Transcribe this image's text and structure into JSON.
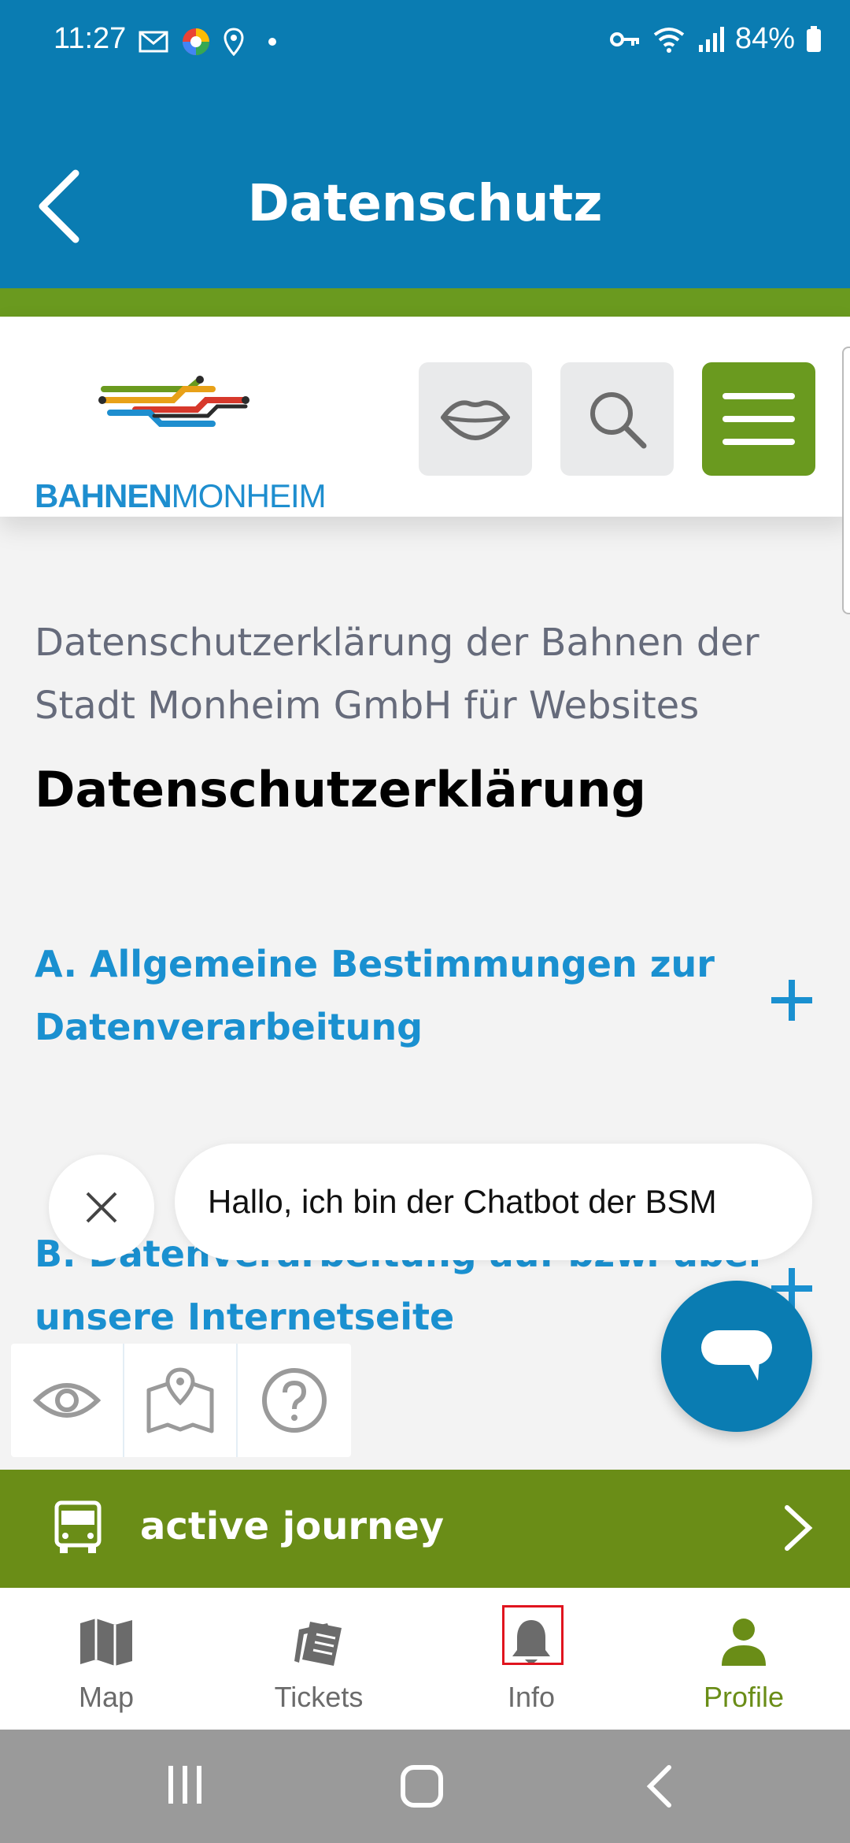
{
  "status_bar": {
    "time": "11:27",
    "battery": "84%"
  },
  "header": {
    "title": "Datenschutz"
  },
  "site": {
    "logo_text_bold": "BAHNEN",
    "logo_text_light": "MONHEIM"
  },
  "content": {
    "intro": "Datenschutzerklärung der Bahnen der Stadt Monheim GmbH für Websites",
    "heading": "Datenschutzerklärung",
    "sections": [
      {
        "title": "A. Allgemeine Bestimmungen zur Datenverarbeitung"
      },
      {
        "title": "B. Datenverarbeitung auf bzw. über unsere Internetseite"
      }
    ]
  },
  "chatbot": {
    "message": "Hallo, ich bin der Chatbot der BSM"
  },
  "journey_bar": {
    "label": "active journey"
  },
  "bottom_nav": {
    "items": [
      {
        "label": "Map",
        "icon": "map-icon"
      },
      {
        "label": "Tickets",
        "icon": "tickets-icon"
      },
      {
        "label": "Info",
        "icon": "bell-icon"
      },
      {
        "label": "Profile",
        "icon": "person-icon"
      }
    ],
    "active": "Profile"
  },
  "colors": {
    "header_blue": "#0a7cb2",
    "brand_green": "#6a9a1f",
    "link_blue": "#1a90d0",
    "highlight_red": "#e0141e"
  }
}
